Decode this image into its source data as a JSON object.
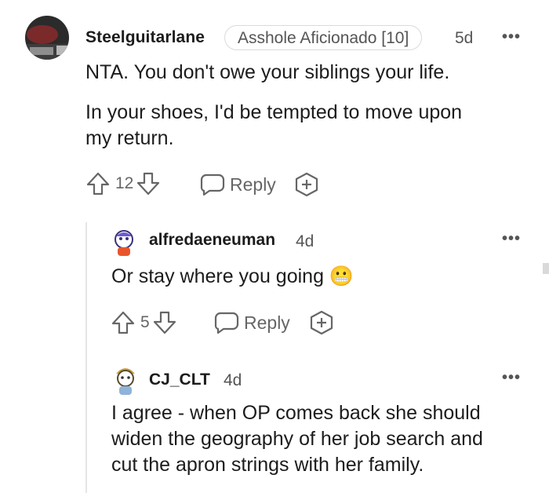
{
  "comments": [
    {
      "username": "Steelguitarlane",
      "flair": "Asshole Aficionado [10]",
      "time": "5d",
      "paragraphs": [
        "NTA. You don't owe your siblings your life.",
        "In your shoes, I'd be tempted to move upon",
        "my return."
      ],
      "votes": "12",
      "reply_label": "Reply",
      "avatar_icon": "user-avatar"
    },
    {
      "username": "alfredaeneuman",
      "time": "4d",
      "text": "Or stay where you going 😬",
      "votes": "5",
      "reply_label": "Reply",
      "avatar_icon": "snoo-avatar"
    },
    {
      "username": "CJ_CLT",
      "time": "4d",
      "lines": [
        "I agree - when OP comes back she should",
        "widen the geography of her job search and",
        "cut the apron strings with her family."
      ],
      "avatar_icon": "snoo-avatar"
    }
  ],
  "more_label": "•••",
  "colors": {
    "text": "#1c1c1c",
    "meta": "#555555",
    "divider": "#e5e5e5"
  }
}
